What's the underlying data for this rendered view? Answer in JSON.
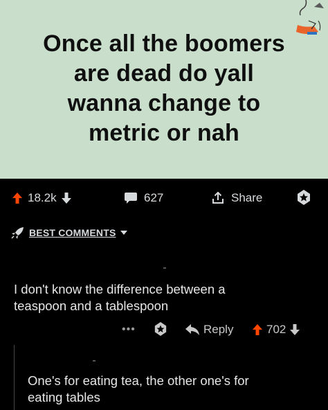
{
  "post": {
    "text_lines": [
      "Once all the boomers",
      "are dead do yall",
      "wanna change to",
      "metric or nah"
    ],
    "upvotes": "18.2k",
    "comments": "627",
    "share_label": "Share"
  },
  "sort": {
    "label": "BEST COMMENTS"
  },
  "comments": [
    {
      "lines": [
        "I don't know the difference between a",
        "teaspoon and a tablespoon"
      ],
      "menu_dots": "•••",
      "reply_label": "Reply",
      "score": "702"
    },
    {
      "lines": [
        "One's for eating tea, the other one's for",
        "eating tables"
      ]
    }
  ],
  "colors": {
    "upvote": "#ff4500",
    "image_bg": "#c9dfcb",
    "background": "#000000"
  }
}
